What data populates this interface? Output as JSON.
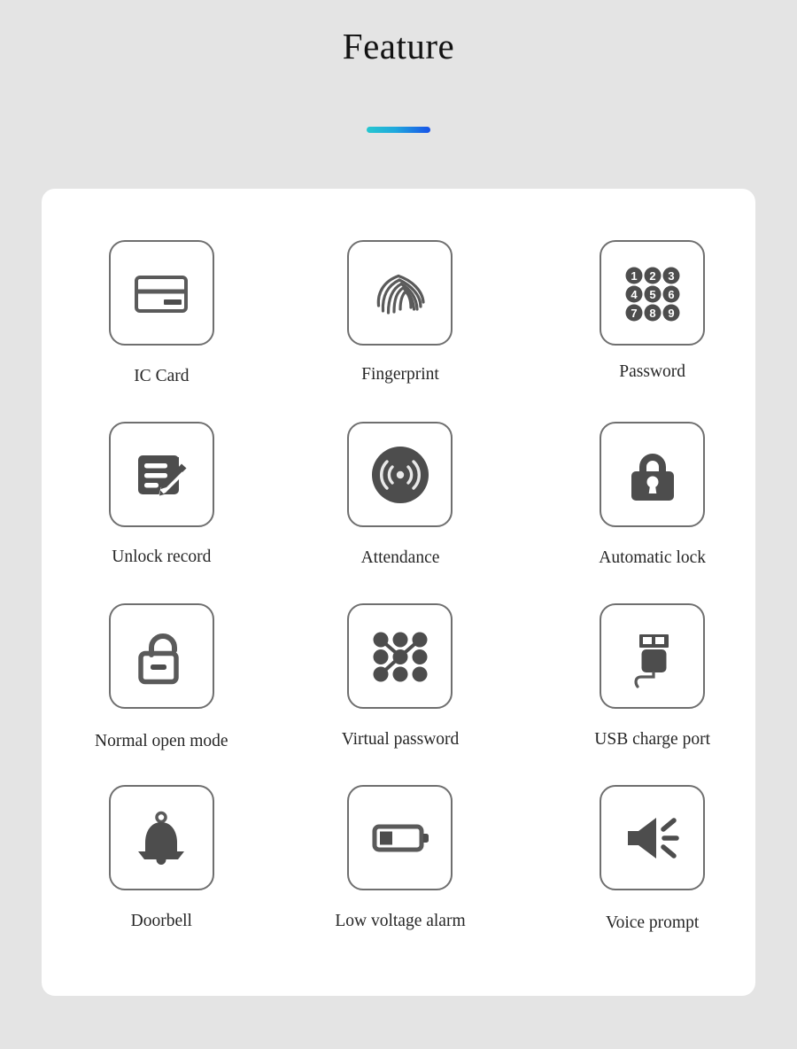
{
  "header": {
    "title": "Feature",
    "accent_gradient_from": "#27c7cf",
    "accent_gradient_to": "#1852e8"
  },
  "theme": {
    "page_background": "#e4e4e4",
    "card_background": "#ffffff",
    "icon_border_color": "#6f6f6f",
    "icon_fill_color": "#4d4d4d",
    "label_color": "#262626"
  },
  "features": [
    {
      "label": "IC Card",
      "icon": "ic-card-icon"
    },
    {
      "label": "Fingerprint",
      "icon": "fingerprint-icon"
    },
    {
      "label": "Password",
      "icon": "keypad-numbers-icon"
    },
    {
      "label": "Unlock record",
      "icon": "record-pencil-icon"
    },
    {
      "label": "Attendance",
      "icon": "signal-waves-icon"
    },
    {
      "label": "Automatic lock",
      "icon": "padlock-closed-icon"
    },
    {
      "label": "Normal open mode",
      "icon": "padlock-open-icon"
    },
    {
      "label": "Virtual password",
      "icon": "pattern-lock-icon"
    },
    {
      "label": "USB charge port",
      "icon": "usb-plug-icon"
    },
    {
      "label": "Doorbell",
      "icon": "bell-icon"
    },
    {
      "label": "Low voltage alarm",
      "icon": "battery-low-icon"
    },
    {
      "label": "Voice prompt",
      "icon": "speaker-icon"
    }
  ],
  "keypad_keys": [
    "1",
    "2",
    "3",
    "4",
    "5",
    "6",
    "7",
    "8",
    "9"
  ]
}
